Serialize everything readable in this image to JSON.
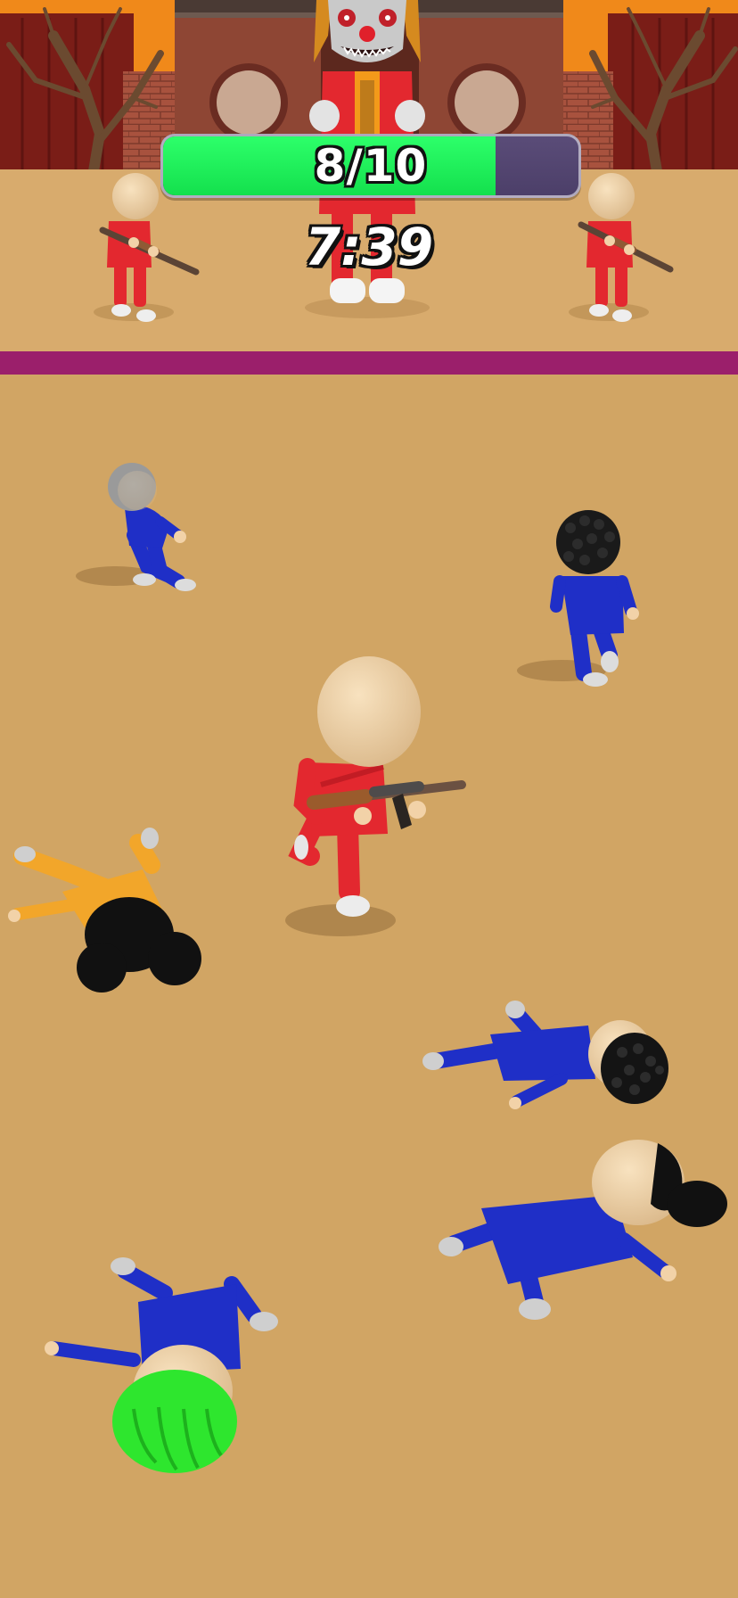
{
  "hud": {
    "progress_text": "8/10",
    "progress_fraction": 0.8,
    "timer": "7:39"
  },
  "colors": {
    "ground": "#d1a564",
    "finish_line": "#9b1f6b",
    "progress_fill": "#1ef15a",
    "progress_track": "#554873"
  }
}
